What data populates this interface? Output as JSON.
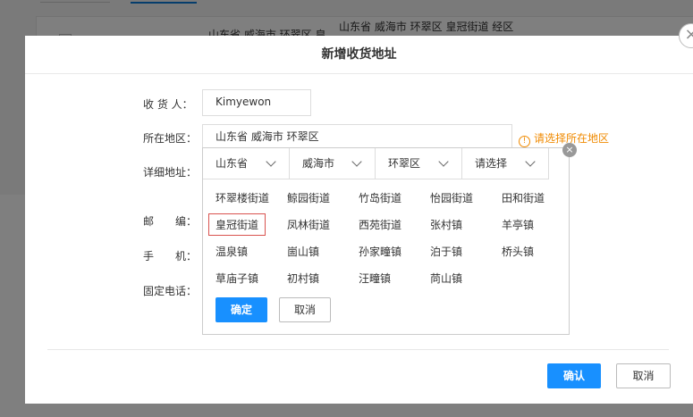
{
  "background": {
    "addr_short": "山东省 威海市 环翠区 皇",
    "addr_full": "山东省 威海市 环翠区 皇冠街道 经区"
  },
  "modal": {
    "title": "新增收货地址",
    "close_icon": "close-icon",
    "fields": {
      "recipient_label": "收 货 人：",
      "recipient_value": "Kimyewon",
      "region_label": "所在地区：",
      "region_value": "山东省 威海市 环翠区",
      "region_warning": "请选择所在地区",
      "detail_label": "详细地址：",
      "zip_label": "邮　　编：",
      "phone_label": "手　　机：",
      "tel_label": "固定电话："
    },
    "region_picker": {
      "tabs": [
        "山东省",
        "威海市",
        "环翠区",
        "请选择"
      ],
      "options": [
        [
          "环翠楼街道",
          "鲸园街道",
          "竹岛街道",
          "怡园街道",
          "田和街道"
        ],
        [
          "皇冠街道",
          "凤林街道",
          "西苑街道",
          "张村镇",
          "羊亭镇"
        ],
        [
          "温泉镇",
          "崮山镇",
          "孙家疃镇",
          "泊于镇",
          "桥头镇"
        ],
        [
          "草庙子镇",
          "初村镇",
          "汪疃镇",
          "苘山镇"
        ]
      ],
      "selected": "皇冠街道",
      "confirm_label": "确定",
      "cancel_label": "取消"
    },
    "footer": {
      "confirm_label": "确认",
      "cancel_label": "取消"
    },
    "colors": {
      "primary": "#1890ff",
      "warning": "#f08a00",
      "selected_border": "#d9534f"
    }
  }
}
